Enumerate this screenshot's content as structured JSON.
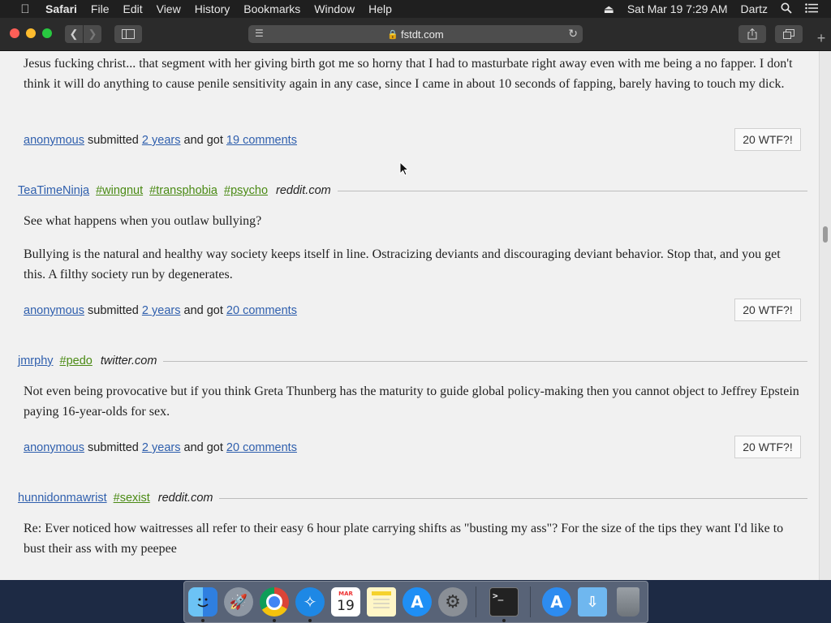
{
  "menubar": {
    "apple_icon": "apple-icon",
    "items": [
      "Safari",
      "File",
      "Edit",
      "View",
      "History",
      "Bookmarks",
      "Window",
      "Help"
    ],
    "datetime": "Sat Mar 19  7:29 AM",
    "user": "Dartz"
  },
  "browser": {
    "url": "fstdt.com"
  },
  "posts": [
    {
      "body": [
        "Jesus fucking christ... that segment with her giving birth got me so horny that I had to masturbate right away even with me being a no fapper. I don't think it will do anything to cause penile sensitivity again in any case, since I came in about 10 seconds of fapping, barely having to touch my dick."
      ],
      "submitter": "anonymous",
      "time": "2 years",
      "comments": "19 comments",
      "wtf": "20 WTF?!"
    },
    {
      "author": "TeaTimeNinja",
      "tags": [
        "#wingnut",
        "#transphobia",
        "#psycho"
      ],
      "source": "reddit.com",
      "body": [
        "See what happens when you outlaw bullying?",
        "Bullying is the natural and healthy way society keeps itself in line. Ostracizing deviants and discouraging deviant behavior. Stop that, and you get this. A filthy society run by degenerates."
      ],
      "submitter": "anonymous",
      "time": "2 years",
      "comments": "20 comments",
      "wtf": "20 WTF?!"
    },
    {
      "author": "jmrphy",
      "tags": [
        "#pedo"
      ],
      "source": "twitter.com",
      "body": [
        "Not even being provocative but if you think Greta Thunberg has the maturity to guide global policy-making then you cannot object to Jeffrey Epstein paying 16-year-olds for sex."
      ],
      "submitter": "anonymous",
      "time": "2 years",
      "comments": "20 comments",
      "wtf": "20 WTF?!"
    },
    {
      "author": "hunnidonmawrist",
      "tags": [
        "#sexist"
      ],
      "source": "reddit.com",
      "body": [
        "Re: Ever noticed how waitresses all refer to their easy 6 hour plate carrying shifts as \"busting my ass\"? For the size of the tips they want I'd like to bust their ass with my peepee"
      ]
    }
  ],
  "meta_words": {
    "submitted": "submitted",
    "and_got": "and got"
  },
  "dock": [
    "finder-icon",
    "launchpad-icon",
    "chrome-icon",
    "safari-icon",
    "calendar-icon",
    "notes-icon",
    "app-store-icon",
    "system-preferences-icon",
    "terminal-icon",
    "applications-folder-icon",
    "downloads-folder-icon",
    "trash-icon"
  ],
  "calendar": {
    "month": "MAR",
    "day": "19"
  },
  "colors": {
    "link": "#2f5fad",
    "tag": "#4a8a14",
    "page_bg": "#f1f1f1"
  }
}
